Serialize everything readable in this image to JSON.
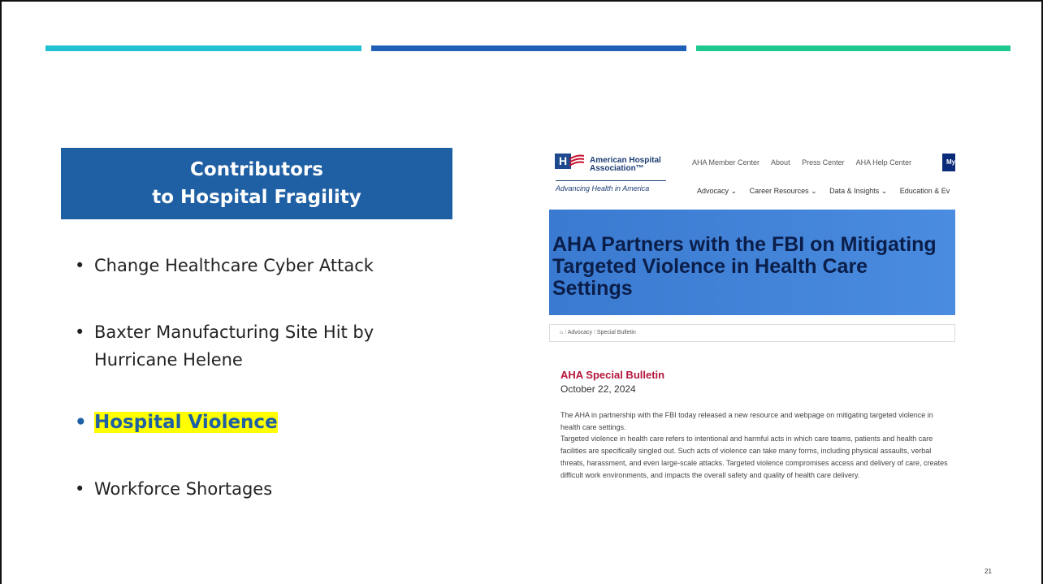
{
  "slide": {
    "title_line1": "Contributors",
    "title_line2": "to Hospital Fragility",
    "bullets": [
      "Change Healthcare Cyber Attack",
      "Baxter Manufacturing Site Hit by Hurricane Helene",
      "Hospital Violence",
      "Workforce Shortages"
    ],
    "page_number": "21",
    "colors": {
      "bar_left": "#21c1d3",
      "bar_middle": "#1f5fb5",
      "bar_right": "#1fc98e",
      "title_box": "#1f5fa3",
      "highlight": "#ffff00"
    }
  },
  "screenshot": {
    "logo_letter": "H",
    "org_name_line1": "American Hospital",
    "org_name_line2": "Association™",
    "tagline": "Advancing Health in America",
    "top_nav": [
      "AHA Member Center",
      "About",
      "Press Center",
      "AHA Help Center"
    ],
    "my_button": "My",
    "main_nav": [
      "Advocacy ⌄",
      "Career Resources ⌄",
      "Data & Insights ⌄",
      "Education & Ev"
    ],
    "hero_title": "AHA Partners with the FBI on Mitigating Targeted Violence in Health Care Settings",
    "breadcrumb": [
      "Advocacy",
      "Special Bulletin"
    ],
    "breadcrumb_icon": "home-icon",
    "bulletin_label": "AHA Special Bulletin",
    "date": "October 22, 2024",
    "paragraph1": "The AHA in partnership with the FBI today released a new resource and webpage on mitigating targeted violence in health care settings.",
    "paragraph2": "Targeted violence in health care refers to intentional and harmful acts in which care teams, patients and health care facilities are specifically singled out. Such acts of violence can take many forms, including physical assaults, verbal threats, harassment, and even large-scale attacks. Targeted violence compromises access and delivery of care, creates difficult work environments, and impacts the overall safety and quality of health care delivery."
  }
}
